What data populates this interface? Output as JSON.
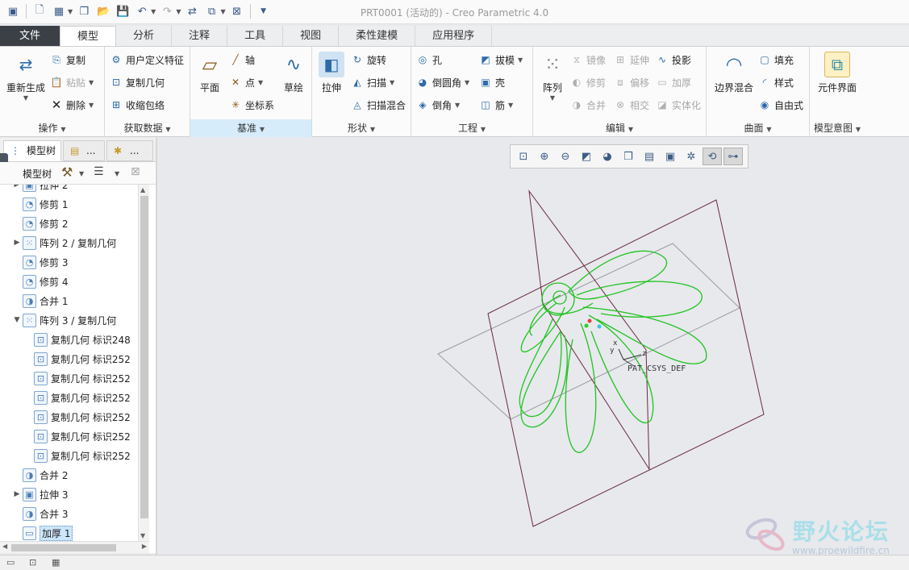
{
  "window": {
    "title": "PRT0001 (活动的) - Creo Parametric 4.0"
  },
  "tabs": [
    "文件",
    "模型",
    "分析",
    "注释",
    "工具",
    "视图",
    "柔性建模",
    "应用程序"
  ],
  "ribbon": {
    "operations": {
      "footer": "操作",
      "regen": "重新生成",
      "copy": "复制",
      "paste": "粘贴",
      "delete": "删除"
    },
    "getdata": {
      "footer": "获取数据",
      "udf": "用户定义特征",
      "copygeom": "复制几何",
      "shrinkwrap": "收缩包络"
    },
    "datum": {
      "footer": "基准",
      "plane": "平面",
      "axis": "轴",
      "point": "点",
      "csys": "坐标系",
      "sketch": "草绘"
    },
    "shapes": {
      "footer": "形状",
      "extrude": "拉伸",
      "revolve": "旋转",
      "sweep": "扫描",
      "sweptblend": "扫描混合"
    },
    "engineering": {
      "footer": "工程",
      "hole": "孔",
      "round": "倒圆角",
      "chamfer": "倒角",
      "draft": "拔模",
      "shell": "壳",
      "rib": "筋"
    },
    "editing": {
      "footer": "编辑",
      "pattern": "阵列",
      "mirror": "镜像",
      "extend": "延伸",
      "project": "投影",
      "trim": "修剪",
      "offset": "偏移",
      "thicken": "加厚",
      "merge": "合并",
      "intersect": "相交",
      "solidify": "实体化"
    },
    "surfaces": {
      "footer": "曲面",
      "boundary": "边界混合",
      "fill": "填充",
      "style": "样式",
      "freestyle": "自由式"
    },
    "intent": {
      "footer": "模型意图",
      "component": "元件界面"
    }
  },
  "lefttabs": {
    "modeltree": "模型树",
    "tab2": "...",
    "tab3": "..."
  },
  "treebar": {
    "label": "模型树"
  },
  "tree": [
    {
      "label": "拉伸 2",
      "exp": "▶",
      "icon": "▣"
    },
    {
      "label": "修剪 1",
      "exp": "",
      "icon": "◔"
    },
    {
      "label": "修剪 2",
      "exp": "",
      "icon": "◔"
    },
    {
      "label": "阵列 2 / 复制几何",
      "exp": "▶",
      "icon": "⁙"
    },
    {
      "label": "修剪 3",
      "exp": "",
      "icon": "◔"
    },
    {
      "label": "修剪 4",
      "exp": "",
      "icon": "◔"
    },
    {
      "label": "合并 1",
      "exp": "",
      "icon": "◑"
    },
    {
      "label": "阵列 3 / 复制几何",
      "exp": "▼",
      "icon": "⁙"
    },
    {
      "label": "复制几何 标识248",
      "exp": "",
      "icon": "⊡",
      "indent": 1
    },
    {
      "label": "复制几何 标识252",
      "exp": "",
      "icon": "⊡",
      "indent": 1
    },
    {
      "label": "复制几何 标识252",
      "exp": "",
      "icon": "⊡",
      "indent": 1
    },
    {
      "label": "复制几何 标识252",
      "exp": "",
      "icon": "⊡",
      "indent": 1
    },
    {
      "label": "复制几何 标识252",
      "exp": "",
      "icon": "⊡",
      "indent": 1
    },
    {
      "label": "复制几何 标识252",
      "exp": "",
      "icon": "⊡",
      "indent": 1
    },
    {
      "label": "复制几何 标识252",
      "exp": "",
      "icon": "⊡",
      "indent": 1
    },
    {
      "label": "合并 2",
      "exp": "",
      "icon": "◑"
    },
    {
      "label": "拉伸 3",
      "exp": "▶",
      "icon": "▣"
    },
    {
      "label": "合并 3",
      "exp": "",
      "icon": "◑"
    },
    {
      "label": "加厚 1",
      "exp": "",
      "icon": "▭",
      "selected": true
    }
  ],
  "viewport": {
    "csys_label": "PAT_CSYS_DEF",
    "axis_x": "x",
    "axis_y": "y",
    "axis_z": "z"
  },
  "watermark": {
    "title": "野火论坛",
    "url": "www.proewildfire.cn"
  },
  "colors": {
    "curve": "#1fc41f",
    "datum_plane": "#6b2a3c",
    "planar_edge": "#9a9aa0",
    "accent": "#2d6aa8"
  }
}
